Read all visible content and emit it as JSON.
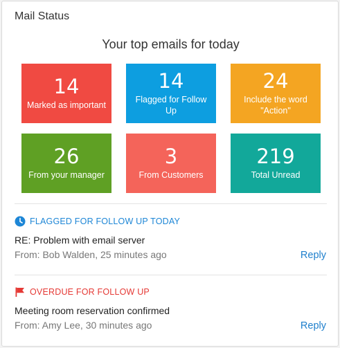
{
  "colors": {
    "red": "#f04a42",
    "blue": "#0d9ee0",
    "orange": "#f4a522",
    "green": "#5fa024",
    "salmon": "#f4645a",
    "teal": "#12a89a",
    "flag_blue": "#1d86d6",
    "overdue_red": "#e53935",
    "link": "#1e7fcc"
  },
  "header": {
    "title": "Mail Status"
  },
  "summary": {
    "heading": "Your top emails for today",
    "tiles": [
      {
        "value": "14",
        "label": "Marked as important"
      },
      {
        "value": "14",
        "label": "Flagged for Follow Up"
      },
      {
        "value": "24",
        "label": "Include the word \"Action\""
      },
      {
        "value": "26",
        "label": "From your manager"
      },
      {
        "value": "3",
        "label": "From Customers"
      },
      {
        "value": "219",
        "label": "Total Unread"
      }
    ]
  },
  "sections": [
    {
      "heading": "FLAGGED FOR FOLLOW UP TODAY",
      "icon": "clock-icon",
      "title": "RE: Problem with email server",
      "from": "From: Bob Walden, 25 minutes ago",
      "action": "Reply"
    },
    {
      "heading": "OVERDUE FOR FOLLOW UP",
      "icon": "flag-icon",
      "title": "Meeting room reservation confirmed",
      "from": "From: Amy Lee, 30 minutes ago",
      "action": "Reply"
    }
  ]
}
